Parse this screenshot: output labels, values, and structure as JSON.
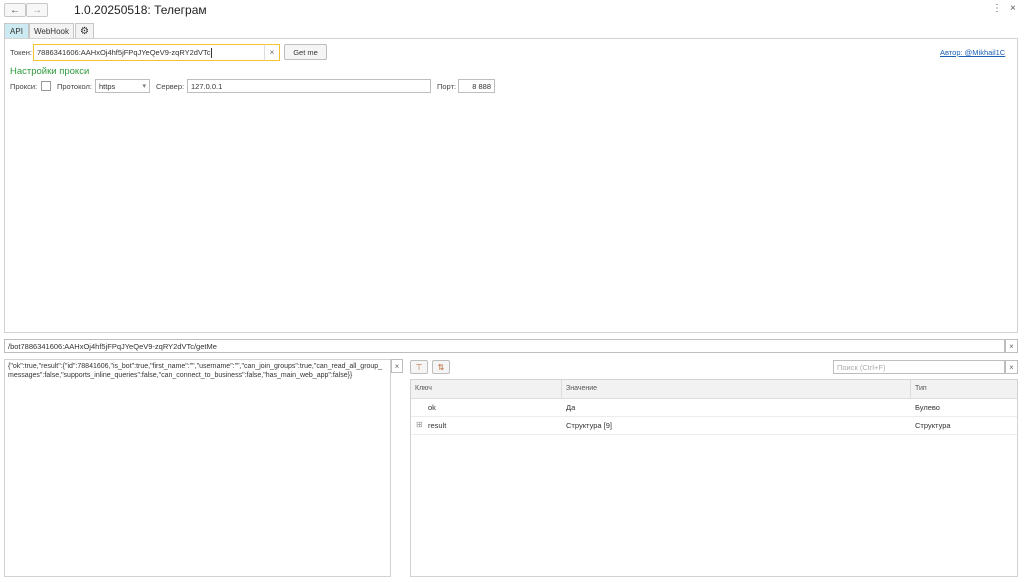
{
  "window": {
    "title": "1.0.20250518: Телеграм",
    "back_icon": "←",
    "forward_icon": "→",
    "more_icon": "⋮",
    "close_icon": "×"
  },
  "tabs": [
    {
      "label": "API"
    },
    {
      "label": "WebHook"
    }
  ],
  "settings_icon": "⚙",
  "form": {
    "token_label": "Токен:",
    "token_value": "7886341606:AAHxOj4hf5jFPqJYeQeV9-zqRY2dVTc",
    "clear_icon": "×",
    "get_me_label": "Get me",
    "author_link": "Автор: @Mikhail1C",
    "proxy_section_title": "Настройки прокси",
    "proxy_label": "Прокси:",
    "protocol_label": "Протокол:",
    "protocol_value": "https",
    "dropdown_icon": "▾",
    "server_label": "Сервер:",
    "server_value": "127.0.0.1",
    "port_label": "Порт:",
    "port_value": "8 888"
  },
  "url_field": {
    "value": "/bot7886341606:AAHxOj4hf5jFPqJYeQeV9-zqRY2dVTc/getMe",
    "clear_icon": "×"
  },
  "json_output": {
    "text": "{\"ok\":true,\"result\":{\"id\":78841606,\"is_bot\":true,\"first_name\":\"\",\"username\":\"\",\"can_join_groups\":true,\"can_read_all_group_messages\":false,\"supports_inline_queries\":false,\"can_connect_to_business\":false,\"has_main_web_app\":false}}",
    "clear_icon": "×"
  },
  "tree_toolbar": {
    "expand_icon": "⊤",
    "sort_icon": "⇅"
  },
  "search": {
    "placeholder": "Поиск (Ctrl+F)",
    "clear_icon": "×"
  },
  "grid": {
    "columns": [
      "Ключ",
      "Значение",
      "Тип"
    ],
    "rows": [
      {
        "key": "ok",
        "value": "Да",
        "type": "Булево",
        "expander": ""
      },
      {
        "key": "result",
        "value": "Структура [9]",
        "type": "Структура",
        "expander": "⊞"
      }
    ]
  }
}
